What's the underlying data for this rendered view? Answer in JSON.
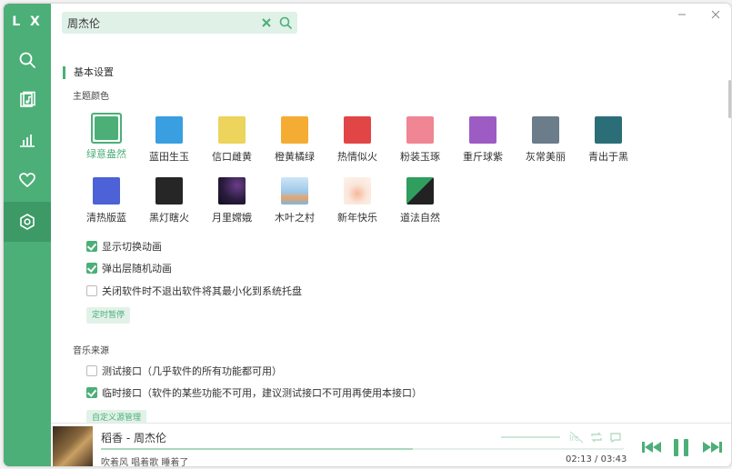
{
  "app": {
    "logo": "L X"
  },
  "colors": {
    "accent": "#4caf78",
    "accent_dark": "#3d9a66",
    "accent_light": "#e0f1e7"
  },
  "sidebar": {
    "items": [
      {
        "name": "search",
        "icon": "search-icon"
      },
      {
        "name": "playlist",
        "icon": "music-file-icon"
      },
      {
        "name": "leaderboard",
        "icon": "bar-chart-icon"
      },
      {
        "name": "favorites",
        "icon": "heart-icon"
      },
      {
        "name": "settings",
        "icon": "settings-icon",
        "active": true
      }
    ]
  },
  "search": {
    "value": "周杰伦",
    "placeholder": ""
  },
  "settings": {
    "section_basic": "基本设置",
    "theme_color_label": "主题颜色",
    "themes": [
      {
        "label": "绿意盎然",
        "color": "#4caf78",
        "selected": true
      },
      {
        "label": "蓝田生玉",
        "color": "#3a9fe0"
      },
      {
        "label": "信口雌黄",
        "color": "#ecd45d"
      },
      {
        "label": "橙黄橘绿",
        "color": "#f5ac32"
      },
      {
        "label": "热情似火",
        "color": "#e24545"
      },
      {
        "label": "粉装玉琢",
        "color": "#f08593"
      },
      {
        "label": "重斤球紫",
        "color": "#9d5bc4"
      },
      {
        "label": "灰常美丽",
        "color": "#6b7c8b"
      },
      {
        "label": "青出于黑",
        "color": "#2c6e78"
      },
      {
        "label": "清热版蓝",
        "color": "#4c62d6"
      },
      {
        "label": "黑灯瞎火",
        "color": "#262626"
      },
      {
        "label": "月里嫦娥",
        "color": "#2a1c3d"
      },
      {
        "label": "木叶之村",
        "color": "#9cc7e8"
      },
      {
        "label": "新年快乐",
        "color": "#fbe6da"
      },
      {
        "label": "道法自然",
        "color": "#2f9e5f"
      }
    ],
    "options": [
      {
        "label": "显示切换动画",
        "checked": true
      },
      {
        "label": "弹出层随机动画",
        "checked": true
      },
      {
        "label": "关闭软件时不退出软件将其最小化到系统托盘",
        "checked": false
      }
    ],
    "timer_button": "定时暂停",
    "music_source_label": "音乐来源",
    "sources": [
      {
        "label": "测试接口（几乎软件的所有功能都可用）",
        "checked": false
      },
      {
        "label": "临时接口（软件的某些功能不可用，建议测试接口不可用再使用本接口）",
        "checked": true
      }
    ],
    "custom_source_button": "自定义源管理"
  },
  "player": {
    "title": "稻香 - 周杰伦",
    "lyric": "吹着风 唱着歌 睡着了",
    "current_time": "02:13",
    "separator": "/",
    "total_time": "03:43",
    "progress": 0.597
  }
}
